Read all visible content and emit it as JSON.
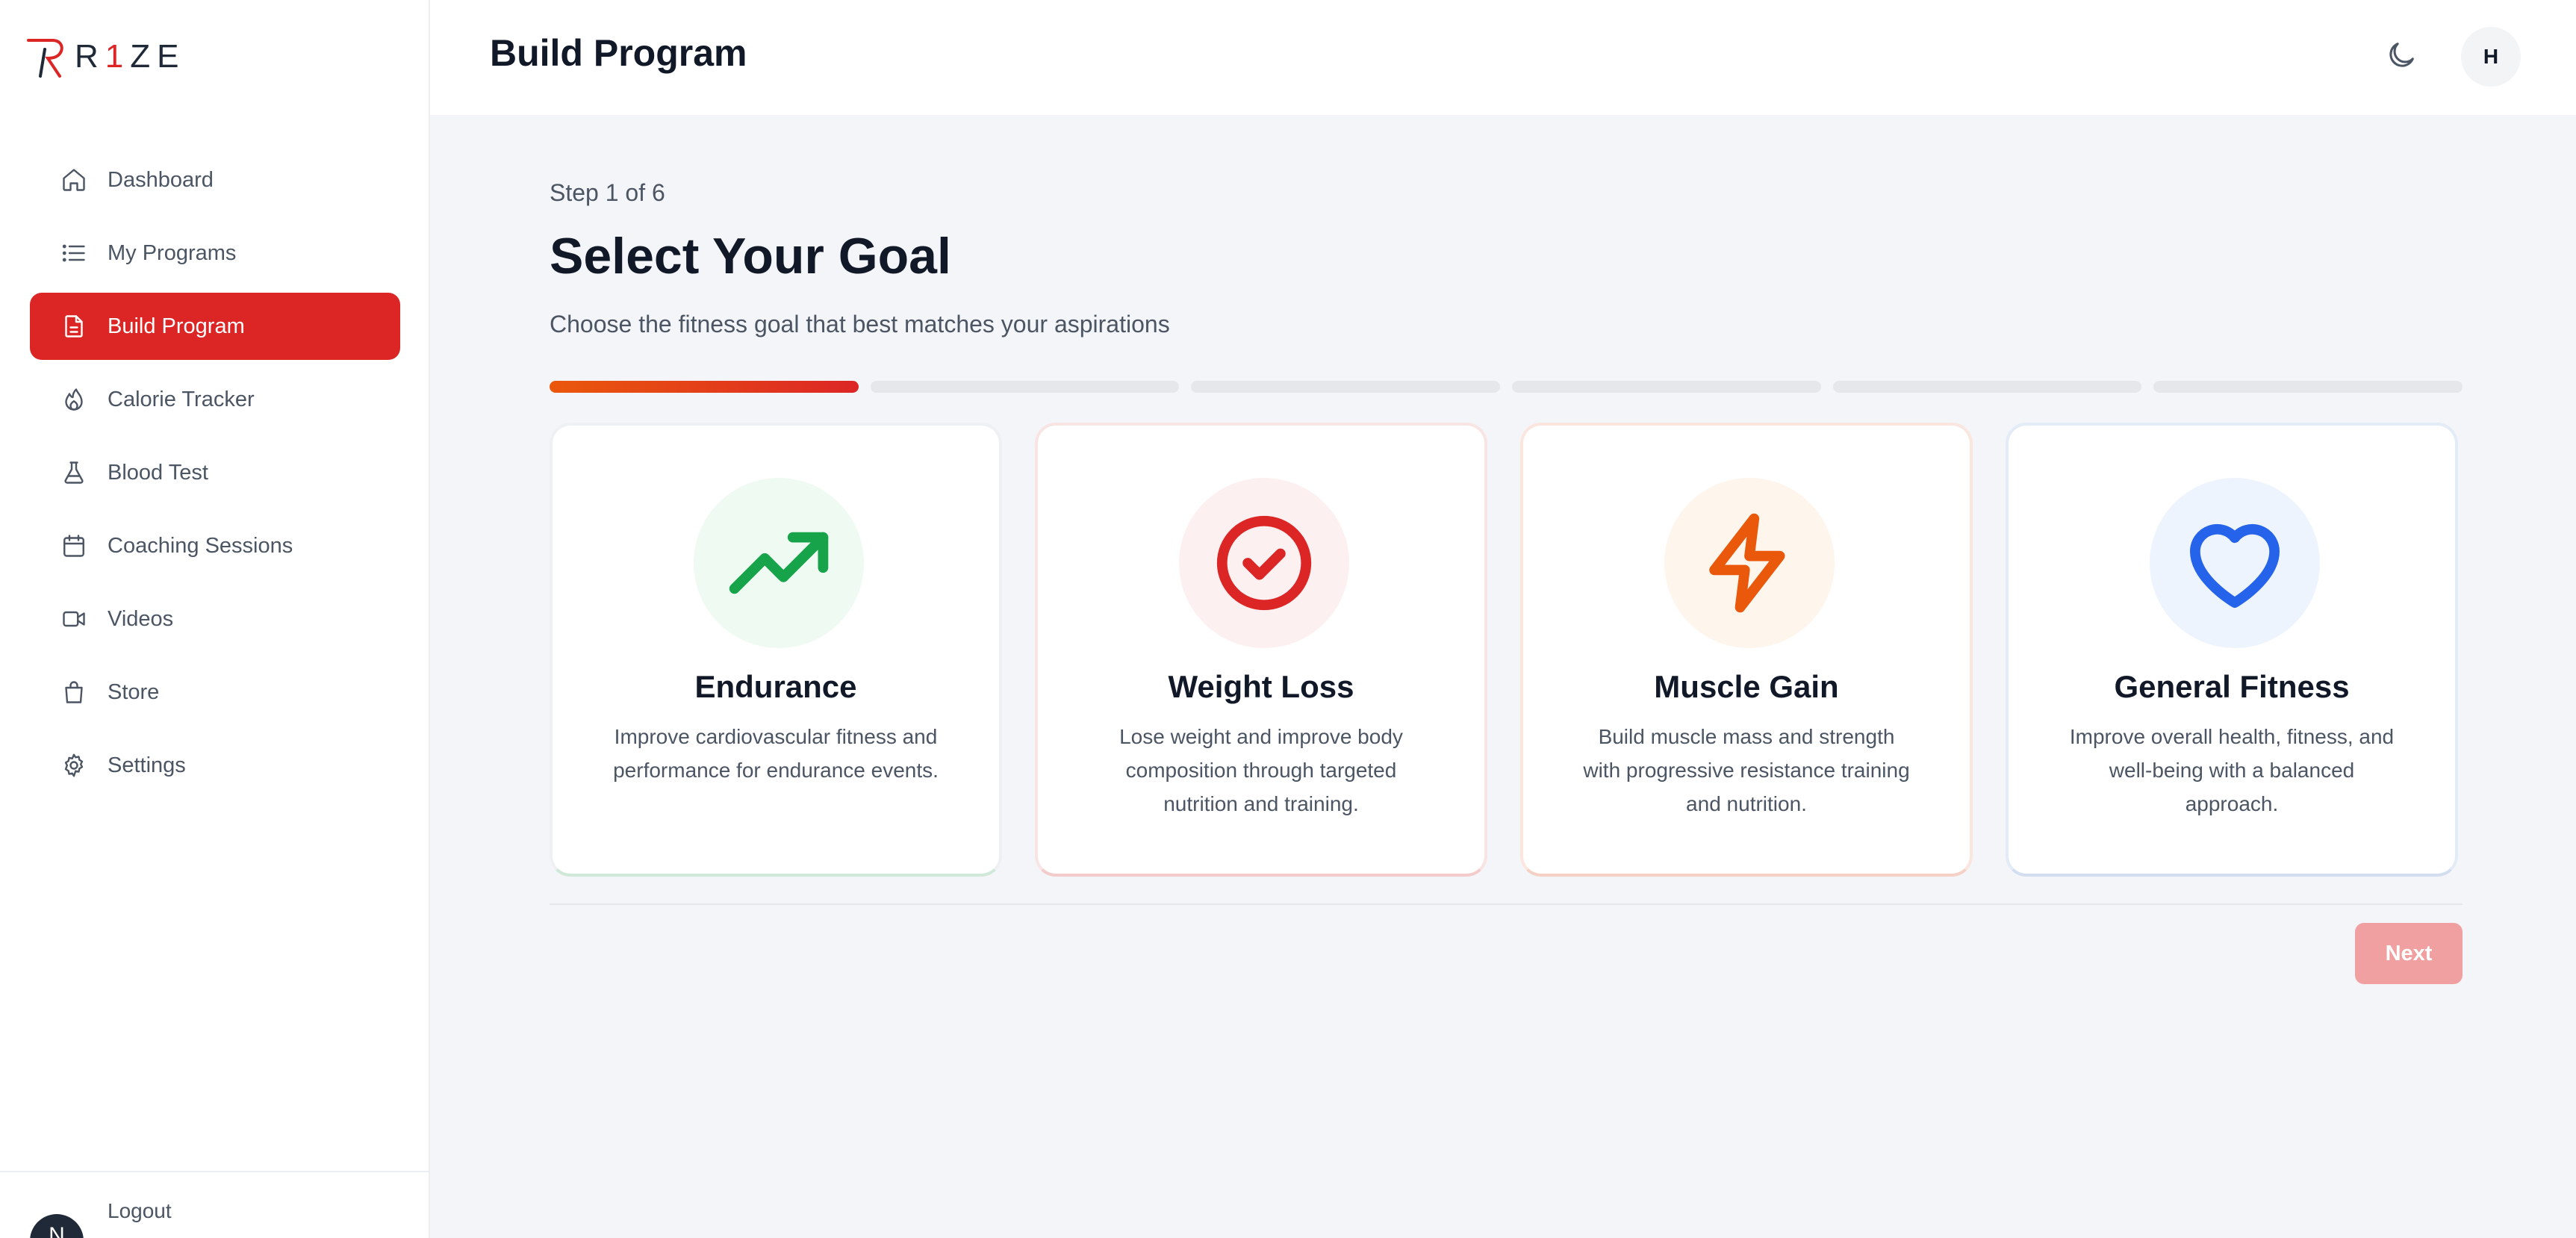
{
  "brand": {
    "name_prefix": "R",
    "name_one": "1",
    "name_suffix": "ZE"
  },
  "header": {
    "title": "Build Program",
    "user_initial": "H"
  },
  "sidebar": {
    "items": [
      {
        "label": "Dashboard",
        "icon": "home-icon"
      },
      {
        "label": "My Programs",
        "icon": "list-icon"
      },
      {
        "label": "Build Program",
        "icon": "document-icon",
        "active": true
      },
      {
        "label": "Calorie Tracker",
        "icon": "flame-icon"
      },
      {
        "label": "Blood Test",
        "icon": "flask-icon"
      },
      {
        "label": "Coaching Sessions",
        "icon": "calendar-icon"
      },
      {
        "label": "Videos",
        "icon": "video-icon"
      },
      {
        "label": "Store",
        "icon": "shopping-bag-icon"
      },
      {
        "label": "Settings",
        "icon": "gear-icon"
      }
    ],
    "footer": {
      "avatar_initial": "N",
      "logout_label": "Logout"
    }
  },
  "wizard": {
    "step_label": "Step 1 of 6",
    "heading": "Select Your Goal",
    "subheading": "Choose the fitness goal that best matches your aspirations",
    "progress": {
      "current": 1,
      "total": 6
    },
    "goals": [
      {
        "title": "Endurance",
        "description": "Improve cardiovascular fitness and performance for endurance events.",
        "icon": "trending-up-icon",
        "color": "#16a34a",
        "bg": "#effaf2"
      },
      {
        "title": "Weight Loss",
        "description": "Lose weight and improve body composition through targeted nutrition and training.",
        "icon": "check-circle-icon",
        "color": "#dc2626",
        "bg": "#fdf0f0"
      },
      {
        "title": "Muscle Gain",
        "description": "Build muscle mass and strength with progressive resistance training and nutrition.",
        "icon": "lightning-icon",
        "color": "#ea580c",
        "bg": "#fef5ec"
      },
      {
        "title": "General Fitness",
        "description": "Improve overall health, fitness, and well-being with a balanced approach.",
        "icon": "heart-icon",
        "color": "#2563eb",
        "bg": "#eef4fd"
      }
    ],
    "next_label": "Next"
  },
  "colors": {
    "accent": "#dc2626",
    "next_disabled": "#f0a0a0"
  }
}
